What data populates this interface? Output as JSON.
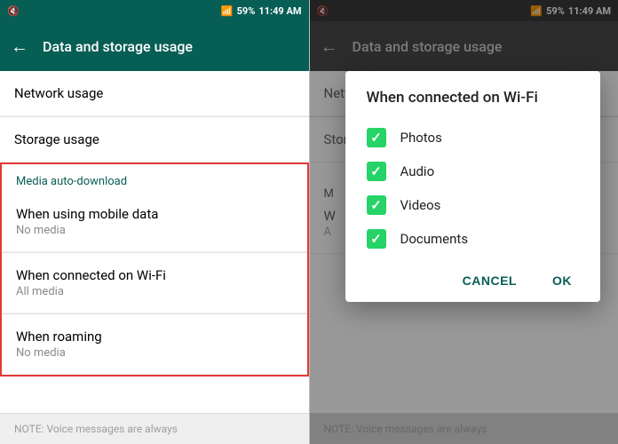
{
  "left_panel": {
    "status_bar": {
      "left": "◀",
      "time": "11:49 AM",
      "icons": "🔇 📶 🔋 59%"
    },
    "toolbar": {
      "back_label": "←",
      "title": "Data and storage usage"
    },
    "items": [
      {
        "id": "network-usage",
        "title": "Network usage",
        "sub": ""
      },
      {
        "id": "storage-usage",
        "title": "Storage usage",
        "sub": ""
      }
    ],
    "media_section": {
      "header": "Media auto-download",
      "items": [
        {
          "id": "mobile-data",
          "title": "When using mobile data",
          "sub": "No media"
        },
        {
          "id": "wifi",
          "title": "When connected on Wi-Fi",
          "sub": "All media"
        },
        {
          "id": "roaming",
          "title": "When roaming",
          "sub": "No media"
        }
      ]
    },
    "footer": "NOTE: Voice messages are always"
  },
  "right_panel": {
    "status_bar": {
      "time": "11:49 AM"
    },
    "toolbar": {
      "back_label": "←",
      "title": "Data and storage usage"
    },
    "items": [
      {
        "id": "network-usage",
        "title": "Network usage",
        "sub": ""
      },
      {
        "id": "storage-usage",
        "title": "Storage usage",
        "sub": ""
      }
    ],
    "media_section": {
      "header": "M",
      "items": [
        {
          "id": "wifi-short",
          "title": "W",
          "sub": "A"
        }
      ]
    },
    "footer": "NOTE: Voice messages are always"
  },
  "dialog": {
    "title": "When connected on Wi-Fi",
    "items": [
      {
        "id": "photos",
        "label": "Photos",
        "checked": true
      },
      {
        "id": "audio",
        "label": "Audio",
        "checked": true
      },
      {
        "id": "videos",
        "label": "Videos",
        "checked": true
      },
      {
        "id": "documents",
        "label": "Documents",
        "checked": true
      }
    ],
    "cancel_label": "CANCEL",
    "ok_label": "OK"
  },
  "colors": {
    "primary": "#075e54",
    "accent": "#25d366",
    "red_border": "#e53935"
  }
}
